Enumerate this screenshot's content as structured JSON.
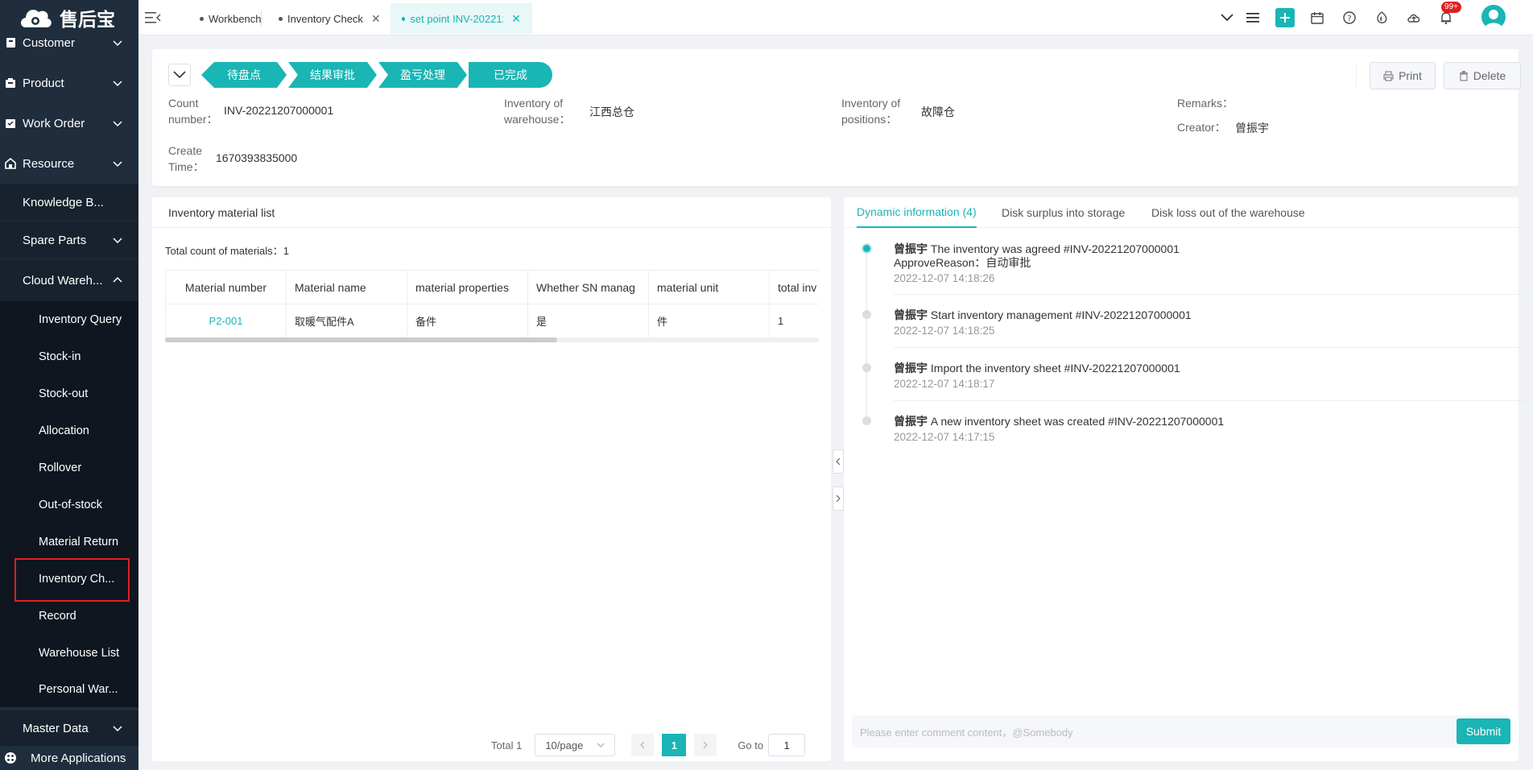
{
  "app": {
    "brand": "售后宝"
  },
  "sidebar": {
    "items": [
      {
        "label": "Customer",
        "icon": "customer-icon"
      },
      {
        "label": "Product",
        "icon": "product-icon"
      },
      {
        "label": "Work Order",
        "icon": "work-order-icon"
      },
      {
        "label": "Resource",
        "icon": "resource-icon"
      }
    ],
    "resource_children": [
      {
        "label": "Knowledge B..."
      },
      {
        "label": "Spare Parts"
      },
      {
        "label": "Cloud Wareh..."
      }
    ],
    "cloud_children": [
      {
        "label": "Inventory Query"
      },
      {
        "label": "Stock-in"
      },
      {
        "label": "Stock-out"
      },
      {
        "label": "Allocation"
      },
      {
        "label": "Rollover"
      },
      {
        "label": "Out-of-stock"
      },
      {
        "label": "Material Return"
      },
      {
        "label": "Inventory Ch..."
      },
      {
        "label": "Record"
      },
      {
        "label": "Warehouse List"
      },
      {
        "label": "Personal War..."
      }
    ],
    "master_data": "Master Data",
    "more_apps": "More Applications"
  },
  "topbar": {
    "tabs": [
      {
        "label": "Workbench"
      },
      {
        "label": "Inventory Check"
      },
      {
        "label": "set point INV-2022120..."
      }
    ],
    "notification_badge": "99+"
  },
  "header": {
    "steps": [
      "待盘点",
      "结果审批",
      "盈亏处理",
      "已完成"
    ],
    "print_label": "Print",
    "delete_label": "Delete",
    "count_number_label": "Count number：",
    "count_number_label_l1": "Count",
    "count_number_label_l2": "number：",
    "count_number": "INV-20221207000001",
    "warehouse_label_l1": "Inventory of",
    "warehouse_label_l2": "warehouse：",
    "warehouse": "江西总仓",
    "positions_label_l1": "Inventory of",
    "positions_label_l2": "positions：",
    "positions": "故障仓",
    "remarks_label": "Remarks：",
    "creator_label": "Creator：",
    "creator": "曾振宇",
    "create_time_label_l1": "Create",
    "create_time_label_l2": "Time：",
    "create_time": "1670393835000"
  },
  "material_list": {
    "title": "Inventory material list",
    "total_count_label": "Total count of materials：",
    "total_count": "1",
    "columns": [
      "Material number",
      "Material name",
      "material properties",
      "Whether SN manag",
      "material unit",
      "total inv"
    ],
    "rows": [
      [
        "P2-001",
        "取暖气配件A",
        "备件",
        "是",
        "件",
        "1"
      ]
    ],
    "pagination": {
      "total_label": "Total 1",
      "page_size": "10/page",
      "current_page": "1",
      "goto_label": "Go to",
      "goto_value": "1"
    }
  },
  "dynamic": {
    "tabs": [
      "Dynamic information (4)",
      "Disk surplus into storage",
      "Disk loss out of the warehouse"
    ],
    "events": [
      {
        "user": "曾振宇",
        "text": " The inventory was agreed #INV-20221207000001",
        "extra": "ApproveReason：自动审批",
        "time": "2022-12-07 14:18:26"
      },
      {
        "user": "曾振宇",
        "text": " Start inventory management #INV-20221207000001",
        "extra": "",
        "time": "2022-12-07 14:18:25"
      },
      {
        "user": "曾振宇",
        "text": " Import the inventory sheet #INV-20221207000001",
        "extra": "",
        "time": "2022-12-07 14:18:17"
      },
      {
        "user": "曾振宇",
        "text": " A new inventory sheet was created #INV-20221207000001",
        "extra": "",
        "time": "2022-12-07 14:17:15"
      }
    ],
    "comment_placeholder": "Please enter comment content，@Somebody",
    "submit_label": "Submit"
  },
  "colors": {
    "accent": "#1ab5b5",
    "sidebar_bg": "#1f2d3d",
    "highlight": "#e02020"
  }
}
